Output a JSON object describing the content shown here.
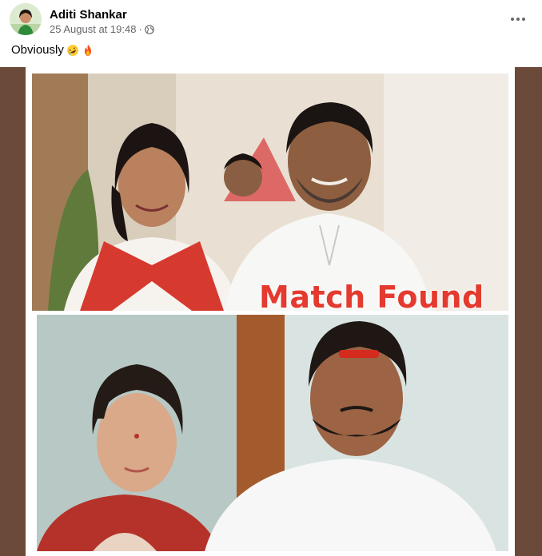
{
  "post": {
    "author": "Aditi Shankar",
    "timestamp": "25 August at 19:48",
    "separator": "·",
    "audience_icon": "globe-icon",
    "more_icon": "more-options-icon",
    "caption": "Obviously",
    "caption_emojis": [
      "rolling-on-floor-laughing-emoji",
      "fire-emoji"
    ]
  },
  "meme": {
    "overlay_text": "Match Found"
  },
  "colors": {
    "name": "#050505",
    "meta": "#65676b",
    "media_bg": "#6b4a3a",
    "overlay_text": "#e43a2f"
  }
}
